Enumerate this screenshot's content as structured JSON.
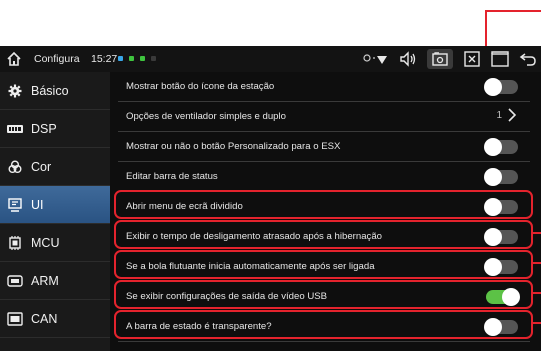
{
  "status_bar": {
    "title": "Configura",
    "time": "15:27",
    "dot_colors": [
      "#39a6e8",
      "#3ec43e",
      "#3ec43e",
      "#3a3a3a"
    ]
  },
  "sidebar": {
    "items": [
      {
        "label": "Básico",
        "icon": "gear-icon",
        "active": false
      },
      {
        "label": "DSP",
        "icon": "equalizer-icon",
        "active": false
      },
      {
        "label": "Cor",
        "icon": "palette-icon",
        "active": false
      },
      {
        "label": "UI",
        "icon": "monitor-icon",
        "active": true
      },
      {
        "label": "MCU",
        "icon": "chip-icon",
        "active": false
      },
      {
        "label": "ARM",
        "icon": "processor-icon",
        "active": false
      },
      {
        "label": "CAN",
        "icon": "can-bus-icon",
        "active": false
      }
    ]
  },
  "settings": {
    "rows": [
      {
        "label": "Mostrar botão do ícone da estação",
        "control": "toggle",
        "on": false
      },
      {
        "label": "Opções de ventilador simples e duplo",
        "control": "value",
        "value": "1"
      },
      {
        "label": "Mostrar ou não o botão Personalizado para o ESX",
        "control": "toggle",
        "on": false
      },
      {
        "label": "Editar barra de status",
        "control": "toggle",
        "on": false
      },
      {
        "label": "Abrir menu de ecrã dividido",
        "control": "toggle",
        "on": false
      },
      {
        "label": "Exibir o tempo de desligamento atrasado após a hibernação",
        "control": "toggle",
        "on": false
      },
      {
        "label": "Se a bola flutuante inicia automaticamente após ser ligada",
        "control": "toggle",
        "on": false
      },
      {
        "label": "Se exibir configurações de saída de vídeo USB",
        "control": "toggle",
        "on": true
      },
      {
        "label": "A barra de estado é transparente?",
        "control": "toggle",
        "on": false
      }
    ]
  },
  "colors": {
    "annotation": "#e4232d",
    "toggle_on": "#5cc246",
    "sidebar_active": "#2f5a8c"
  }
}
